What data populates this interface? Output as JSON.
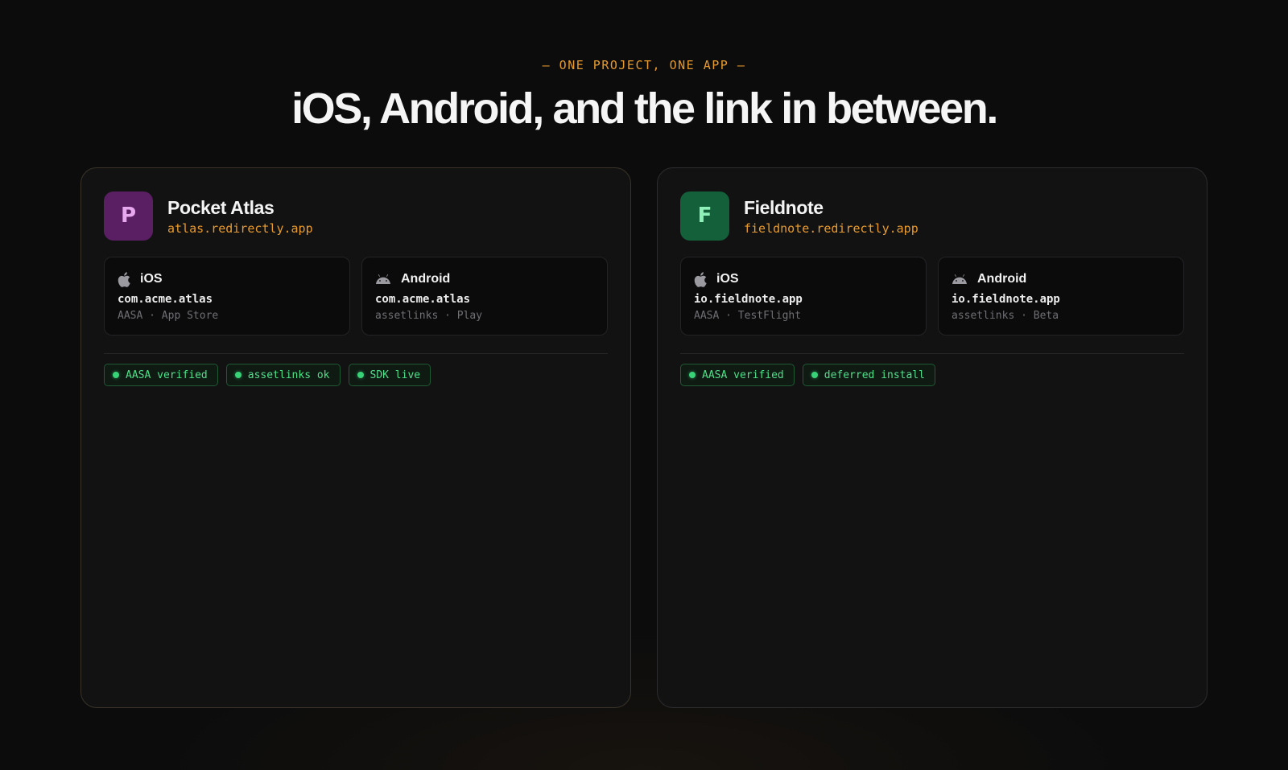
{
  "hero": {
    "eyebrow": "— ONE PROJECT, ONE APP —",
    "title": "iOS, Android, and the link in between."
  },
  "colors": {
    "accent": "#e89a2c",
    "success": "#4fe08a",
    "pocket_atlas_icon_bg": "#5a1f63",
    "pocket_atlas_icon_fg": "#e7a8f0",
    "fieldnote_icon_bg": "#13603a",
    "fieldnote_icon_fg": "#8ff0b8"
  },
  "projects": [
    {
      "initial": "P",
      "name": "Pocket Atlas",
      "domain": "atlas.redirectly.app",
      "ios": {
        "label": "iOS",
        "bundle": "com.acme.atlas",
        "sub": "AASA · App Store",
        "icon": "apple-icon"
      },
      "android": {
        "label": "Android",
        "bundle": "com.acme.atlas",
        "sub": "assetlinks · Play",
        "icon": "android-icon"
      },
      "badges": [
        "AASA verified",
        "assetlinks ok",
        "SDK live"
      ]
    },
    {
      "initial": "F",
      "name": "Fieldnote",
      "domain": "fieldnote.redirectly.app",
      "ios": {
        "label": "iOS",
        "bundle": "io.fieldnote.app",
        "sub": "AASA · TestFlight",
        "icon": "apple-icon"
      },
      "android": {
        "label": "Android",
        "bundle": "io.fieldnote.app",
        "sub": "assetlinks · Beta",
        "icon": "android-icon"
      },
      "badges": [
        "AASA verified",
        "deferred install"
      ]
    }
  ]
}
